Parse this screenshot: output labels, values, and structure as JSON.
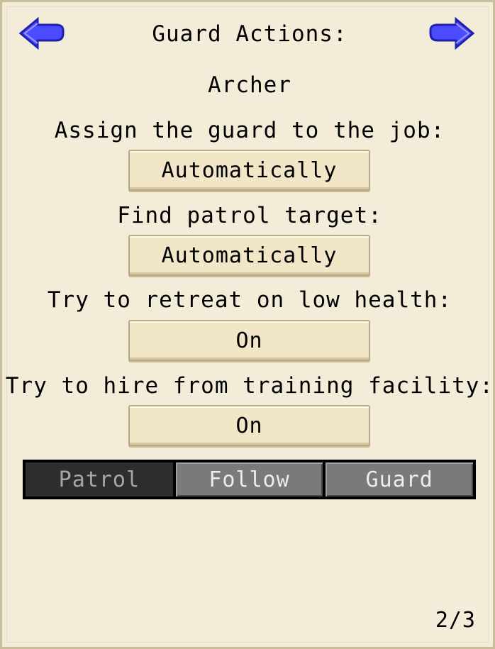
{
  "header": {
    "title": "Guard Actions:",
    "subtitle": "Archer",
    "prev_icon": "back-arrow-icon",
    "next_icon": "forward-arrow-icon",
    "arrow_color": "#4b4bff"
  },
  "settings": [
    {
      "label": "Assign the guard to the job:",
      "value": "Automatically"
    },
    {
      "label": "Find patrol target:",
      "value": "Automatically"
    },
    {
      "label": "Try to retreat on low health:",
      "value": "On"
    },
    {
      "label": "Try to hire from training facility:",
      "value": "On"
    }
  ],
  "tabs": [
    {
      "label": "Patrol",
      "active": true
    },
    {
      "label": "Follow",
      "active": false
    },
    {
      "label": "Guard",
      "active": false
    }
  ],
  "pagination": {
    "text": "2/3"
  }
}
